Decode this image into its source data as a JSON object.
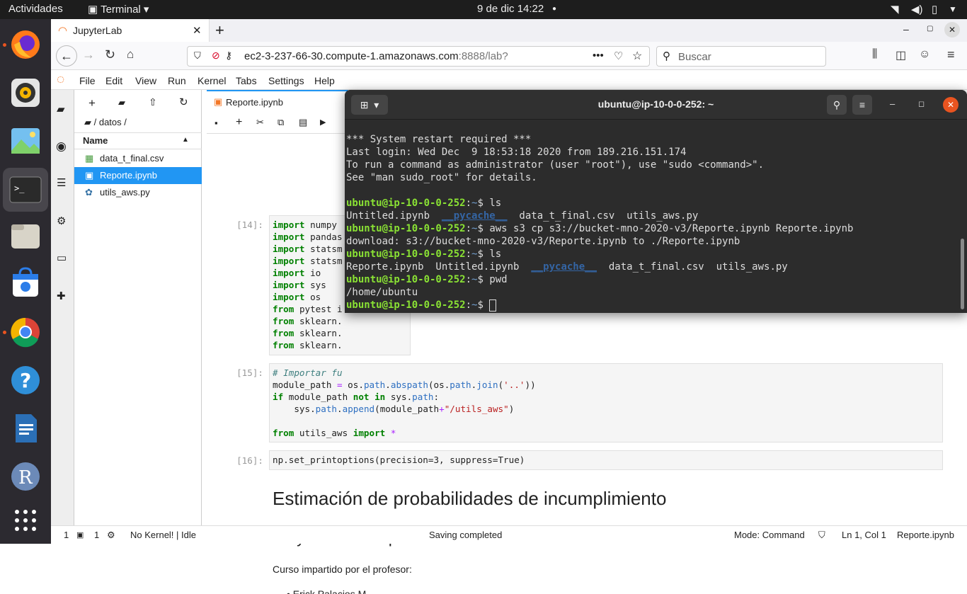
{
  "topbar": {
    "activities": "Actividades",
    "app": "Terminal",
    "clock": "9 de dic  14:22"
  },
  "browser": {
    "tab_title": "JupyterLab",
    "url_main": "ec2-3-237-66-30.compute-1.amazonaws.com",
    "url_rest": ":8888/lab?",
    "search_placeholder": "Buscar"
  },
  "jupyter": {
    "menu": [
      "File",
      "Edit",
      "View",
      "Run",
      "Kernel",
      "Tabs",
      "Settings",
      "Help"
    ],
    "breadcrumb": "/ datos /",
    "name_header": "Name",
    "files": [
      "data_t_final.csv",
      "Reporte.ipynb",
      "utils_aws.py"
    ],
    "notebook_tab": "Reporte.ipynb",
    "cells": {
      "p14": "[14]:",
      "p15": "[15]:",
      "p16": "[16]:",
      "c14": [
        "numpy",
        "pandas",
        "statsm",
        "statsm",
        "io",
        "sys",
        "os",
        "pytest i",
        "sklearn.",
        "sklearn.",
        "sklearn."
      ],
      "c15_comment": "# Importar fu",
      "c16": "np.set_printoptions(precision=3, suppress=True)"
    },
    "md_h1": "Estimación de probabilidades de incumplimiento",
    "md_h2": "Proyecto Final Optimización",
    "md_p": "Curso impartido por el profesor:",
    "md_li": "Erick Palacios M"
  },
  "status": {
    "n1": "1",
    "n2": "1",
    "kernel": "No Kernel! | Idle",
    "saving": "Saving completed",
    "mode": "Mode: Command",
    "pos": "Ln 1, Col 1",
    "file": "Reporte.ipynb"
  },
  "terminal": {
    "title": "ubuntu@ip-10-0-0-252: ~",
    "prompt": "ubuntu@ip-10-0-0-252",
    "lines": {
      "l1": "*** System restart required ***",
      "l2": "Last login: Wed Dec  9 18:53:18 2020 from 189.216.151.174",
      "l3": "To run a command as administrator (user \"root\"), use \"sudo <command>\".",
      "l4": "See \"man sudo_root\" for details.",
      "cmd1": "ls",
      "out1a": "Untitled.ipynb  ",
      "out1b": "__pycache__",
      "out1c": "  data_t_final.csv  utils_aws.py",
      "cmd2": "aws s3 cp s3://bucket-mno-2020-v3/Reporte.ipynb Reporte.ipynb",
      "out2": "download: s3://bucket-mno-2020-v3/Reporte.ipynb to ./Reporte.ipynb",
      "cmd3": "ls",
      "out3a": "Reporte.ipynb  Untitled.ipynb  ",
      "out3b": "__pycache__",
      "out3c": "  data_t_final.csv  utils_aws.py",
      "cmd4": "pwd",
      "out4": "/home/ubuntu"
    }
  }
}
